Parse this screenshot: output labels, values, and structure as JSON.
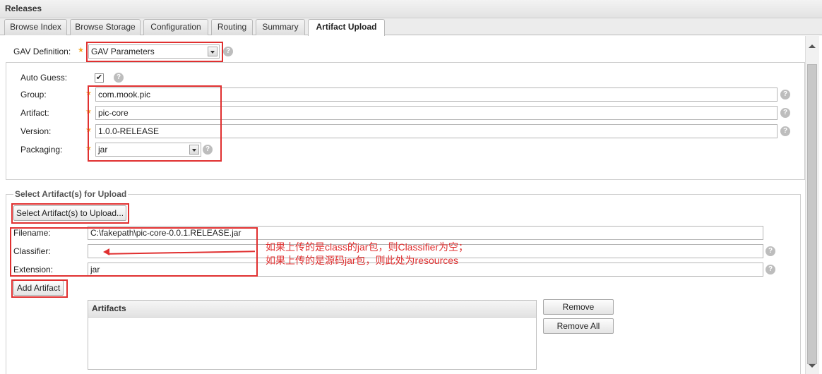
{
  "window": {
    "title": "Releases"
  },
  "tabs": [
    {
      "label": "Browse Index"
    },
    {
      "label": "Browse Storage"
    },
    {
      "label": "Configuration"
    },
    {
      "label": "Routing"
    },
    {
      "label": "Summary"
    },
    {
      "label": "Artifact Upload",
      "active": true
    }
  ],
  "gav": {
    "definition_label": "GAV Definition:",
    "definition_value": "GAV Parameters",
    "auto_guess_label": "Auto Guess:",
    "auto_guess_checked": true,
    "auto_guess_mark": "✔",
    "group_label": "Group:",
    "group_value": "com.mook.pic",
    "artifact_label": "Artifact:",
    "artifact_value": "pic-core",
    "version_label": "Version:",
    "version_value": "1.0.0-RELEASE",
    "packaging_label": "Packaging:",
    "packaging_value": "jar"
  },
  "upload": {
    "legend": "Select Artifact(s) for Upload",
    "select_button": "Select Artifact(s) to Upload...",
    "filename_label": "Filename:",
    "filename_value": "C:\\fakepath\\pic-core-0.0.1.RELEASE.jar",
    "classifier_label": "Classifier:",
    "classifier_value": "",
    "extension_label": "Extension:",
    "extension_value": "jar",
    "add_button": "Add Artifact"
  },
  "artifacts": {
    "header": "Artifacts",
    "remove_button": "Remove",
    "remove_all_button": "Remove All"
  },
  "annotation": {
    "line1": "如果上传的是class的jar包，则Classifier为空；",
    "line2": "如果上传的是源码jar包，则此处为resources",
    "color": "#e03030"
  },
  "icons": {
    "help": "?",
    "required": "★"
  }
}
